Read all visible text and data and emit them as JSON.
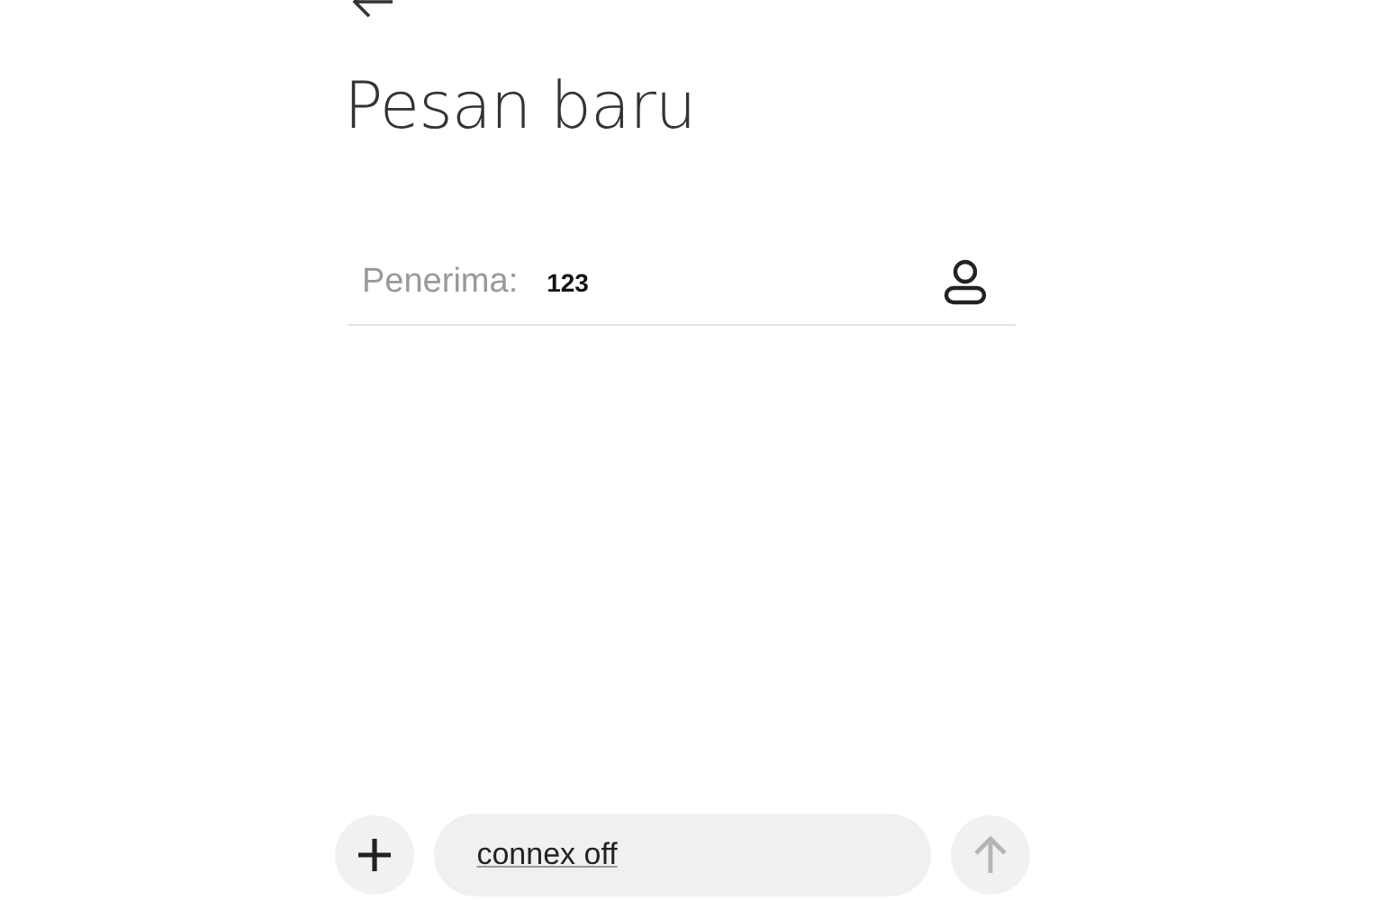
{
  "title": "Pesan baru",
  "recipient": {
    "label": "Penerima:",
    "value": "123"
  },
  "compose": {
    "value": "connex off",
    "send_disabled": true
  }
}
